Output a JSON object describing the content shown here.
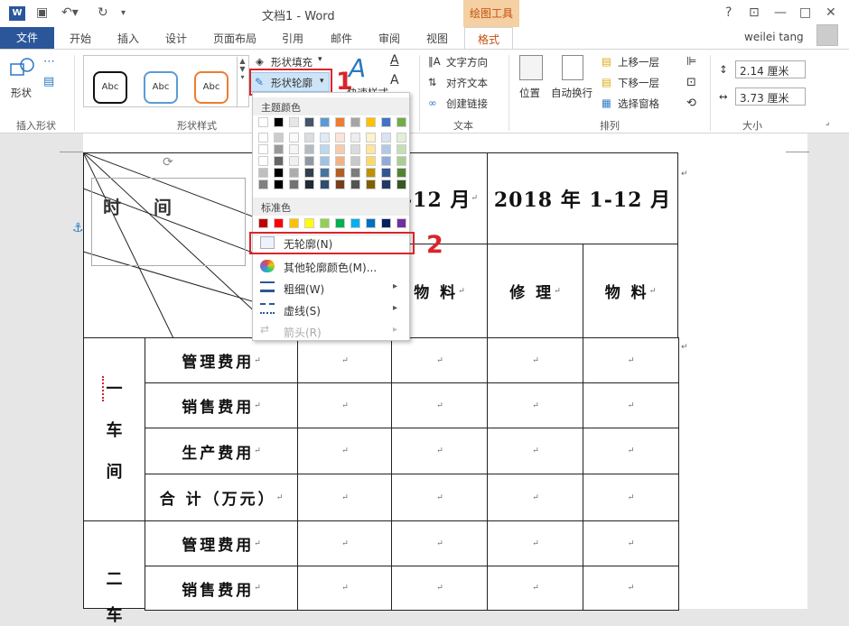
{
  "titlebar": {
    "doc_title": "文档1 - Word",
    "drawing_tools": "绘图工具",
    "help": "?",
    "ribbon_opts": "⊡",
    "minimize": "—",
    "maximize": "□",
    "close": "✕"
  },
  "tabs": {
    "file": "文件",
    "home": "开始",
    "insert": "插入",
    "design": "设计",
    "layout": "页面布局",
    "references": "引用",
    "mailings": "邮件",
    "review": "审阅",
    "view": "视图",
    "format": "格式"
  },
  "user": "weilei tang",
  "ribbon": {
    "shape_label": "形状",
    "insert_shapes": "插入形状",
    "style_sample": "Abc",
    "shape_styles": "形状样式",
    "shape_fill": "形状填充",
    "shape_outline": "形状轮廓",
    "quick_styles": "快速样式",
    "text_dir": "文字方向",
    "align_text": "对齐文本",
    "create_link": "创建链接",
    "text_group": "文本",
    "position": "位置",
    "wrap": "自动换行",
    "bring_forward": "上移一层",
    "send_backward": "下移一层",
    "selection_pane": "选择窗格",
    "arrange": "排列",
    "height": "2.14 厘米",
    "width": "3.73 厘米",
    "size": "大小"
  },
  "annotations": {
    "one": "1",
    "two": "2"
  },
  "menu": {
    "theme_colors": "主题颜色",
    "standard_colors": "标准色",
    "no_outline": "无轮廓(N)",
    "more_colors": "其他轮廓颜色(M)...",
    "weight": "粗细(W)",
    "dashes": "虚线(S)",
    "arrows": "箭头(R)",
    "theme_top": [
      "#ffffff",
      "#000000",
      "#e7e6e6",
      "#44546a",
      "#5b9bd5",
      "#ed7d31",
      "#a5a5a5",
      "#ffc000",
      "#4472c4",
      "#70ad47"
    ],
    "standard": [
      "#c00000",
      "#ff0000",
      "#ffc000",
      "#ffff00",
      "#92d050",
      "#00b050",
      "#00b0f0",
      "#0070c0",
      "#002060",
      "#7030a0"
    ]
  },
  "table": {
    "time": "时",
    "time2": "间",
    "year_a": "-12 月",
    "year_b": "2018 年 1-12 月",
    "material": "物 料",
    "repair": "修 理",
    "material2": "物 料",
    "workshop1": [
      "一",
      "车",
      "间"
    ],
    "workshop2": [
      "二",
      "车"
    ],
    "rows": [
      "管理费用",
      "销售费用",
      "生产费用",
      "合 计（万元）",
      "管理费用",
      "销售费用"
    ]
  }
}
